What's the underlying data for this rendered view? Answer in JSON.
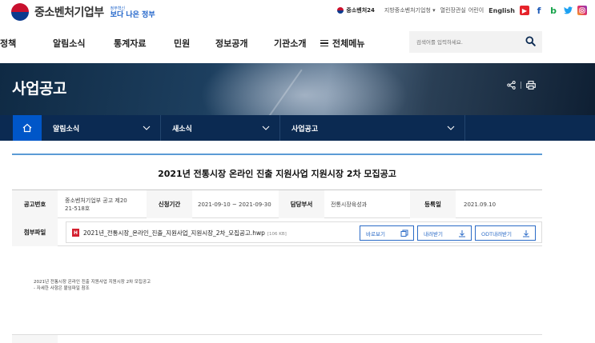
{
  "header": {
    "logo_text": "중소벤처기업부",
    "sub_logo_top": "정부혁신",
    "sub_logo_main": "보다 나은 정부",
    "util_links": [
      "중소벤처24",
      "지방중소벤처기업청",
      "열린장관실",
      "어린이",
      "English"
    ],
    "sns": [
      "youtube",
      "facebook",
      "blog",
      "twitter",
      "instagram"
    ]
  },
  "gnb": {
    "items": [
      "정책",
      "알림소식",
      "통계자료",
      "민원",
      "정보공개",
      "기관소개"
    ],
    "all_menu": "전체메뉴",
    "search_placeholder": "검색어를 입력하세요."
  },
  "banner": {
    "title": "사업공고"
  },
  "location": {
    "depth1": "알림소식",
    "depth2": "새소식",
    "depth3": "사업공고"
  },
  "post": {
    "title": "2021년 전통시장 온라인 진출 지원사업 지원시장 2차 모집공고",
    "labels": {
      "notice_no": "공고번호",
      "period": "신청기간",
      "dept": "담당부서",
      "date": "등록일",
      "attach": "첨부파일"
    },
    "notice_no_line1": "중소벤처기업부 공고 제20",
    "notice_no_line2": "21-518호",
    "period": "2021-09-10 ~ 2021-09-30",
    "dept": "전통시장육성과",
    "date": "2021.09.10",
    "file_name": "2021년_전통시장_온라인_진출_지원사업_지원시장_2차_모집공고.hwp",
    "file_size": "[106 KB]",
    "btn_preview": "바로보기",
    "btn_download": "내려받기",
    "btn_odt": "ODT내려받기",
    "body_line1": "2021년 전통시장 온라인 진출 지원사업 지원시장 2차 모집공고",
    "body_line2": "- 자세한 사항은 붙임파일 참조"
  },
  "colors": {
    "nav_bg": "#0b2a52",
    "home_bg": "#0056c8",
    "accent_blue": "#2b6bc7",
    "rule_blue": "#5b9bd5"
  }
}
